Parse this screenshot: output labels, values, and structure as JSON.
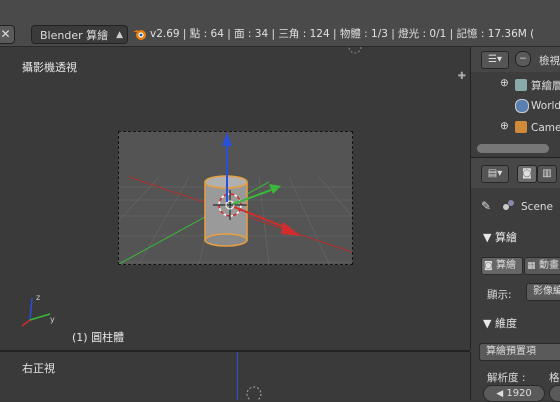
{
  "header": {
    "close_glyph": "✕",
    "render_engine": "Blender 算繪",
    "stats": "v2.69 | 點 : 64 | 面 : 34 | 三角 : 124 | 物體 : 1/3 | 燈光 : 0/1 | 記憶 : 17.36M ("
  },
  "viewport": {
    "title": "攝影機透視",
    "object_label": "(1) 圓柱體"
  },
  "viewport2": {
    "title": "右正視"
  },
  "outliner": {
    "view_label": "檢視",
    "items": [
      {
        "label": "算繪層"
      },
      {
        "label": "World"
      },
      {
        "label": "Came"
      }
    ]
  },
  "properties": {
    "scene_label": "Scene",
    "render_section": "▼ 算繪",
    "render_button": "算繪",
    "animation_button": "動畫",
    "display_label": "顯示:",
    "display_value": "影像編",
    "dimensions_section": "▼ 維度",
    "preset_value": "算繪預置項",
    "resolution_label": "解析度 :",
    "resolution_value": "1920",
    "frame_label": "格"
  },
  "colors": {
    "x_axis": "#d22c2c",
    "y_axis": "#3ab83a",
    "z_axis": "#2a4fd8",
    "selected_outline": "#e8a040"
  }
}
